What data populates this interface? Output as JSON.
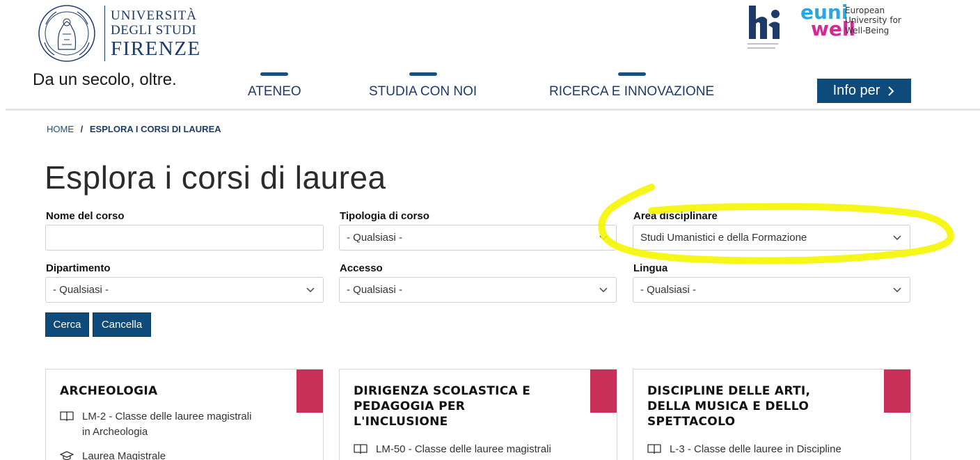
{
  "header": {
    "logo": {
      "line1": "UNIVERSITÀ",
      "line2": "DEGLI STUDI",
      "line3": "FIRENZE"
    },
    "tagline": "Da un secolo, oltre.",
    "nav": [
      {
        "label": "ATENEO"
      },
      {
        "label": "STUDIA CON NOI"
      },
      {
        "label": "RICERCA E INNOVAZIONE"
      }
    ],
    "info_button": "Info per",
    "euni": {
      "top": "euni",
      "bottom": "well",
      "text": [
        "European",
        "University for",
        "Well-Being"
      ]
    }
  },
  "breadcrumb": {
    "home": "HOME",
    "separator": "/",
    "current": "ESPLORA I CORSI DI LAUREA"
  },
  "page_title": "Esplora i corsi di laurea",
  "filters": {
    "nome_corso": {
      "label": "Nome del corso",
      "value": ""
    },
    "tipologia": {
      "label": "Tipologia di corso",
      "value": "- Qualsiasi -"
    },
    "area": {
      "label": "Area disciplinare",
      "value": "Studi Umanistici e della Formazione"
    },
    "dipartimento": {
      "label": "Dipartimento",
      "value": "- Qualsiasi -"
    },
    "accesso": {
      "label": "Accesso",
      "value": "- Qualsiasi -"
    },
    "lingua": {
      "label": "Lingua",
      "value": "- Qualsiasi -"
    }
  },
  "buttons": {
    "search": "Cerca",
    "clear": "Cancella"
  },
  "cards": [
    {
      "title_lines": [
        "ARCHEOLOGIA"
      ],
      "class_lines": [
        "LM-2 - Classe delle lauree magistrali",
        "in Archeologia"
      ],
      "type": "Laurea Magistrale"
    },
    {
      "title_lines": [
        "DIRIGENZA SCOLASTICA E",
        "PEDAGOGIA PER",
        "L'INCLUSIONE"
      ],
      "class_lines": [
        "LM-50 - Classe delle lauree magistrali"
      ]
    },
    {
      "title_lines": [
        "DISCIPLINE DELLE ARTI,",
        "DELLA MUSICA E DELLO",
        "SPETTACOLO"
      ],
      "class_lines": [
        "L-3 - Classe delle lauree in Discipline"
      ]
    }
  ],
  "colors": {
    "primary": "#0e4a7a",
    "accent": "#c8305a",
    "highlight": "#f5f500"
  }
}
